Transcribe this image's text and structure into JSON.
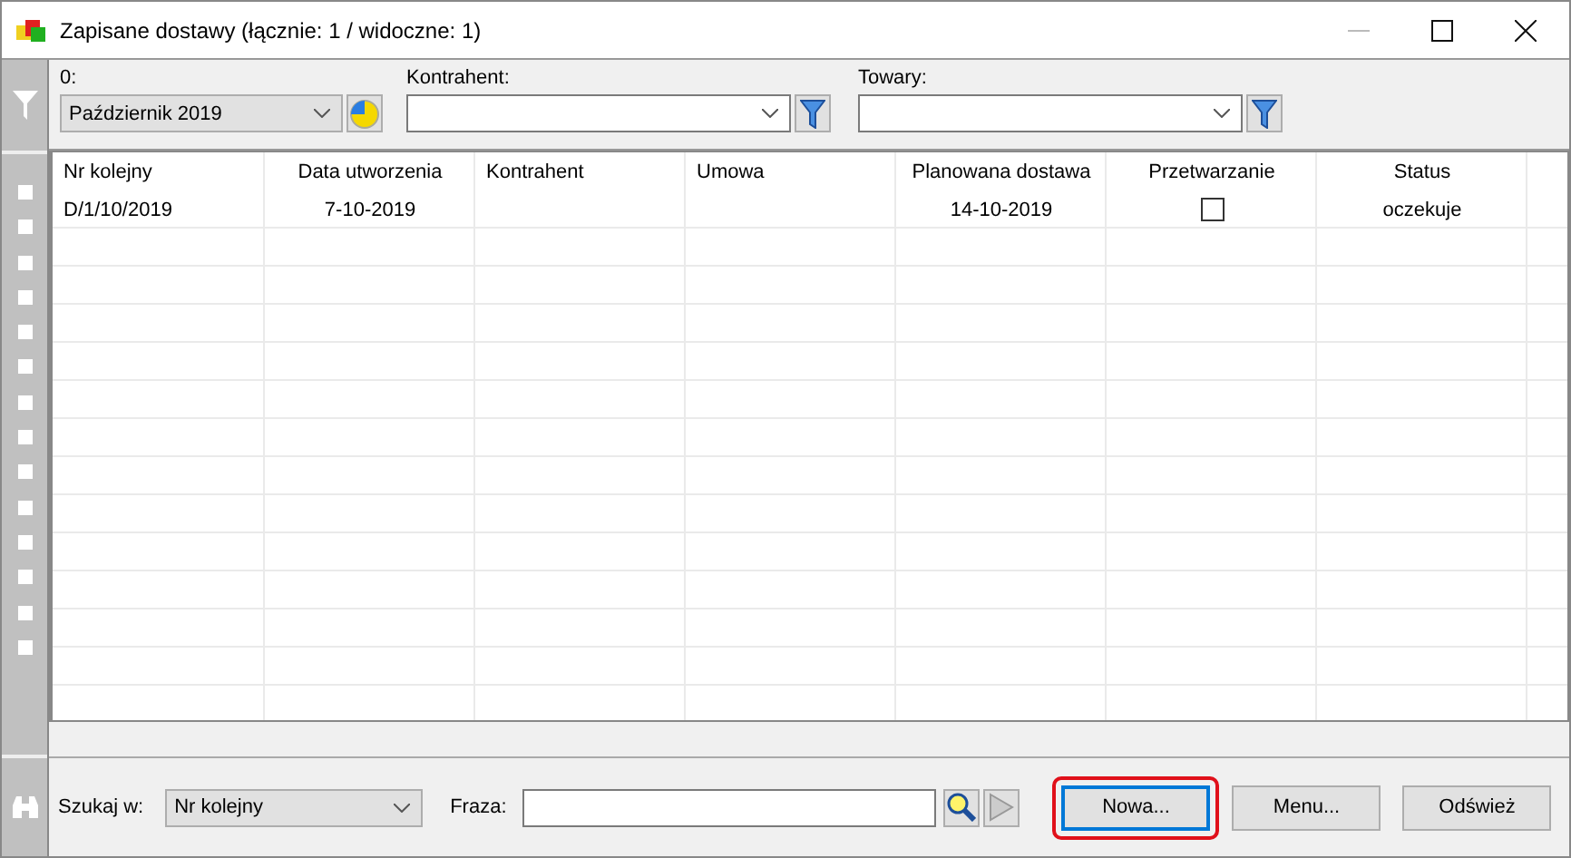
{
  "window": {
    "title": "Zapisane dostawy (łącznie: 1 / widoczne: 1)"
  },
  "filters": [
    {
      "kind": "period",
      "label": "0:",
      "value": "Październik 2019"
    },
    {
      "kind": "lookup",
      "label": "Kontrahent:"
    },
    {
      "kind": "lookup",
      "label": "Towary:"
    }
  ],
  "table": {
    "columns": [
      {
        "label": "Nr kolejny"
      },
      {
        "label": "Data utworzenia"
      },
      {
        "label": "Kontrahent"
      },
      {
        "label": "Umowa"
      },
      {
        "label": "Planowana dostawa"
      },
      {
        "label": "Przetwarzanie"
      },
      {
        "label": "Status"
      }
    ],
    "rows": [
      {
        "cells": [
          {
            "kind": "text",
            "text": "D/1/10/2019"
          },
          {
            "kind": "text",
            "text": "7-10-2019"
          },
          {
            "kind": "empty"
          },
          {
            "kind": "empty"
          },
          {
            "kind": "text",
            "text": "14-10-2019"
          },
          {
            "kind": "checkbox",
            "checked": false
          },
          {
            "kind": "text",
            "text": "oczekuje"
          }
        ]
      }
    ]
  },
  "search": {
    "in_label": "Szukaj w:",
    "in_value": "Nr kolejny",
    "phrase_label": "Fraza:"
  },
  "buttons": [
    {
      "label": "Nowa...",
      "highlighted": true
    },
    {
      "label": "Menu...",
      "highlighted": false
    },
    {
      "label": "Odśwież",
      "highlighted": false
    }
  ]
}
